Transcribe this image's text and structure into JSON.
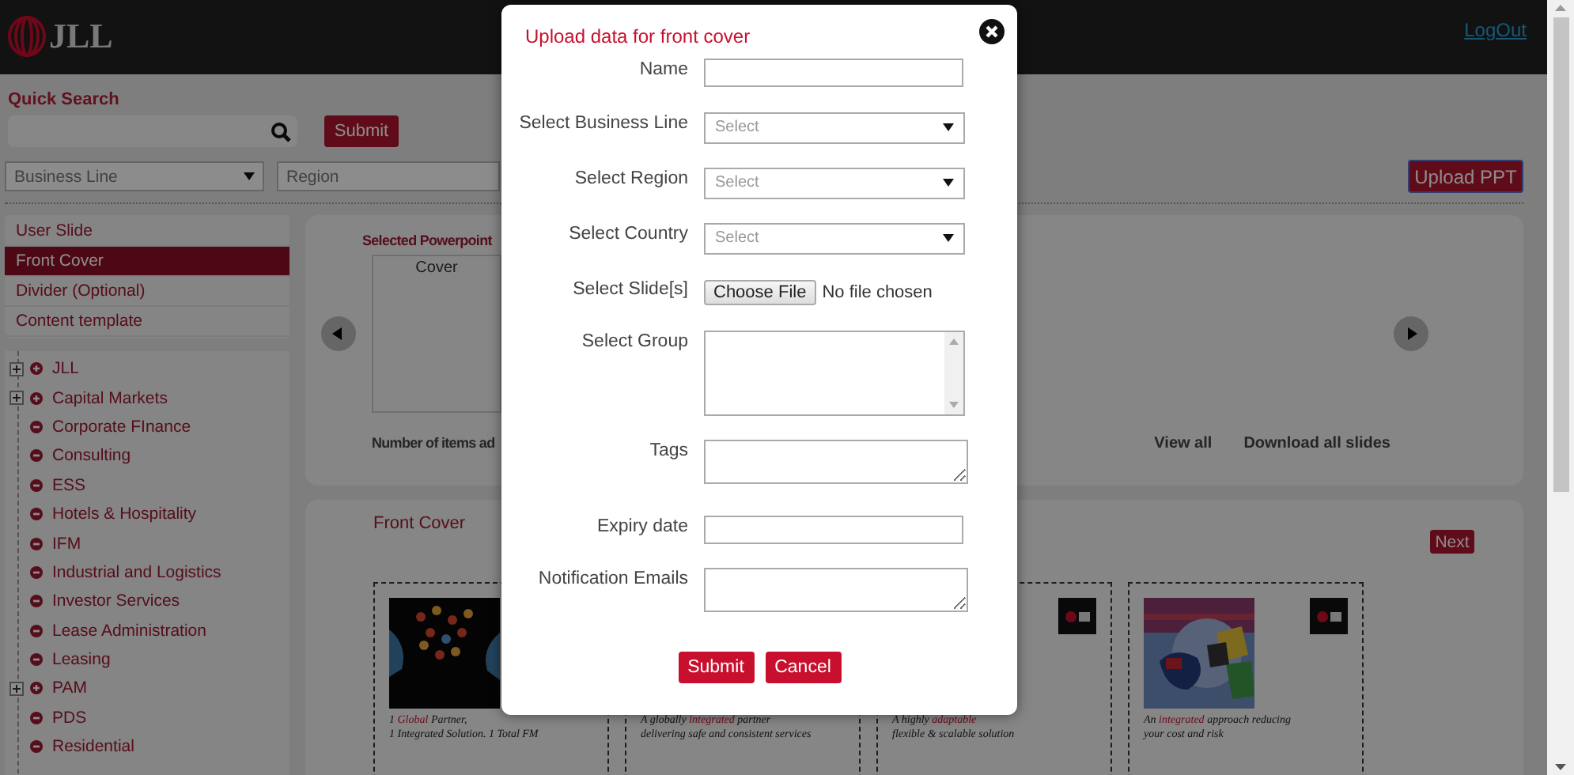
{
  "header": {
    "logo": "JLL",
    "logout": "LogOut"
  },
  "quick_search": {
    "title": "Quick Search",
    "submit": "Submit"
  },
  "filters": {
    "business_line": "Business Line",
    "region": "Region"
  },
  "upload_button": "Upload PPT",
  "sidebar": {
    "menu": [
      {
        "label": "User Slide",
        "selected": false
      },
      {
        "label": "Front Cover",
        "selected": true
      },
      {
        "label": "Divider (Optional)",
        "selected": false
      },
      {
        "label": "Content template",
        "selected": false
      }
    ],
    "tree": [
      {
        "label": "JLL",
        "kind": "group"
      },
      {
        "label": "Capital Markets",
        "kind": "group"
      },
      {
        "label": "Corporate FInance",
        "kind": "leaf"
      },
      {
        "label": "Consulting",
        "kind": "leaf"
      },
      {
        "label": "ESS",
        "kind": "leaf"
      },
      {
        "label": "Hotels & Hospitality",
        "kind": "leaf"
      },
      {
        "label": "IFM",
        "kind": "leaf"
      },
      {
        "label": "Industrial and Logistics",
        "kind": "leaf"
      },
      {
        "label": "Investor Services",
        "kind": "leaf"
      },
      {
        "label": "Lease Administration",
        "kind": "leaf"
      },
      {
        "label": "Leasing",
        "kind": "leaf"
      },
      {
        "label": "PAM",
        "kind": "group"
      },
      {
        "label": "PDS",
        "kind": "leaf"
      },
      {
        "label": "Residential",
        "kind": "leaf"
      }
    ]
  },
  "selected_panel": {
    "title": "Selected Powerpoint",
    "cover_label": "Cover",
    "items_count": "Number of items ad",
    "links": [
      "View all",
      "Download all slides"
    ]
  },
  "front_cover_panel": {
    "title": "Front Cover",
    "next": "Next",
    "cards": [
      {
        "picture": true,
        "logo": false,
        "caption": [
          "1 *Global* Partner,",
          "1 Integrated Solution. 1 Total FM"
        ]
      },
      {
        "picture": false,
        "logo": false,
        "caption": [
          "A globally *integrated* partner",
          "delivering safe and consistent services"
        ]
      },
      {
        "picture": false,
        "logo": true,
        "caption": [
          "A highly *adaptable*",
          "flexible & scalable solution"
        ]
      },
      {
        "picture": true,
        "logo": true,
        "caption": [
          "An *integrated* approach reducing",
          "your cost and risk"
        ]
      }
    ]
  },
  "modal": {
    "title": "Upload data for front cover",
    "fields": [
      {
        "label": "Name",
        "kind": "text"
      },
      {
        "label": "Select Business Line",
        "kind": "select",
        "value": "Select"
      },
      {
        "label": "Select Region",
        "kind": "select",
        "value": "Select"
      },
      {
        "label": "Select Country",
        "kind": "select",
        "value": "Select"
      },
      {
        "label": "Select Slide[s]",
        "kind": "file",
        "button": "Choose File",
        "status": "No file chosen"
      },
      {
        "label": "Select Group",
        "kind": "listbox"
      },
      {
        "label": "Tags",
        "kind": "textarea"
      },
      {
        "label": "Expiry date",
        "kind": "text"
      },
      {
        "label": "Notification Emails",
        "kind": "textarea"
      }
    ],
    "buttons": [
      "Submit",
      "Cancel"
    ]
  }
}
